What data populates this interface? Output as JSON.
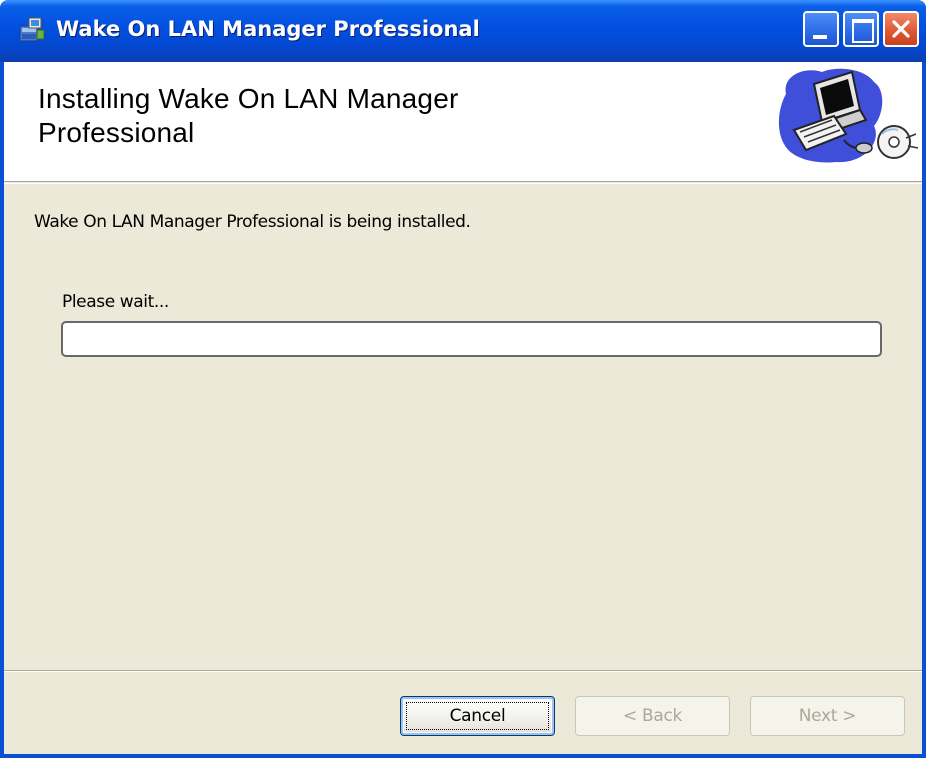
{
  "window": {
    "title": "Wake On LAN Manager Professional",
    "controls": [
      "minimize-button",
      "maximize-button",
      "close-button"
    ]
  },
  "banner": {
    "title": "Installing Wake On LAN Manager Professional",
    "graphic": "computer-cd-graphic"
  },
  "body": {
    "status_text": "Wake On LAN Manager Professional is being installed.",
    "wait_label": "Please wait...",
    "progress_percent": 0
  },
  "buttons": {
    "cancel": "Cancel",
    "back": "< Back",
    "next": "Next >"
  },
  "colors": {
    "titlebar": "#0451E0",
    "client_bg": "#ECE9D8",
    "close_button": "#E05A36"
  }
}
